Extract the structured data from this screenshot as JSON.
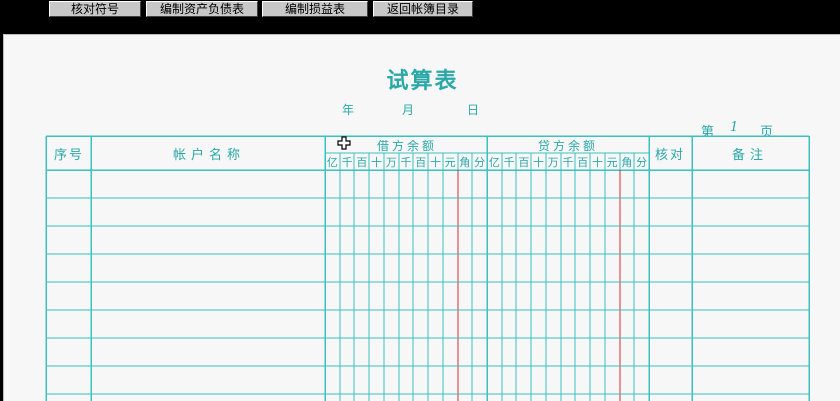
{
  "toolbar": {
    "buttons": [
      {
        "label": "核对符号"
      },
      {
        "label": "编制资产负债表"
      },
      {
        "label": "编制损益表"
      },
      {
        "label": "返回帐簿目录"
      }
    ]
  },
  "sheet": {
    "title": "试算表",
    "year_label": "年",
    "month_label": "月",
    "day_label": "日",
    "page_prefix": "第",
    "page_number": "1",
    "page_suffix": "页"
  },
  "table": {
    "headers": {
      "seq": "序号",
      "account": "帐户名称",
      "debit": "借方余额",
      "credit": "贷方余额",
      "check": "核对",
      "remark": "备注"
    },
    "digit_units": [
      "亿",
      "千",
      "百",
      "十",
      "万",
      "千",
      "百",
      "十",
      "元",
      "角",
      "分"
    ],
    "row_count": 8
  },
  "colors": {
    "line": "#3cc0c0",
    "text": "#2aa8a8",
    "decimal_line": "#d23030",
    "background": "#f7f7f7"
  }
}
